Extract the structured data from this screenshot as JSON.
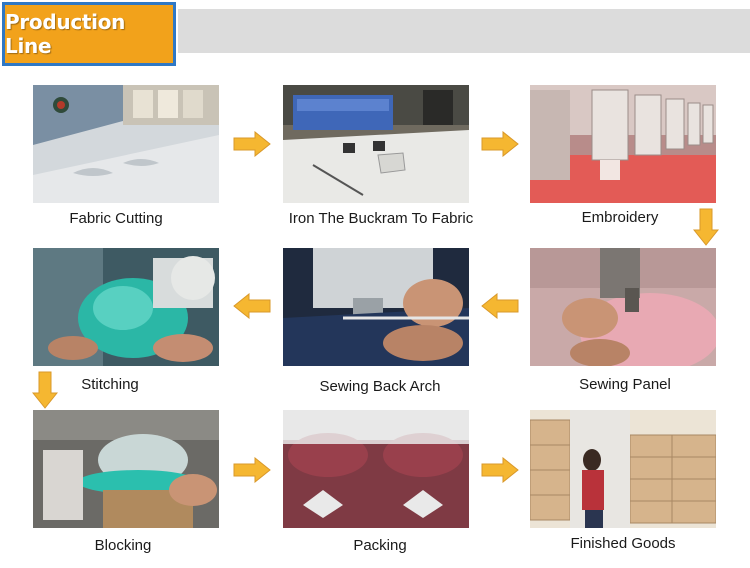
{
  "header": {
    "title": "Production Line"
  },
  "steps": [
    {
      "label": "Fabric Cutting"
    },
    {
      "label": "Iron The Buckram To Fabric"
    },
    {
      "label": "Embroidery"
    },
    {
      "label": "Sewing Panel"
    },
    {
      "label": "Sewing Back Arch"
    },
    {
      "label": "Stitching"
    },
    {
      "label": "Blocking"
    },
    {
      "label": "Packing"
    },
    {
      "label": "Finished Goods"
    }
  ],
  "colors": {
    "accent": "#f2a21b",
    "border": "#2f78c5",
    "arrow": "#f5b731"
  }
}
